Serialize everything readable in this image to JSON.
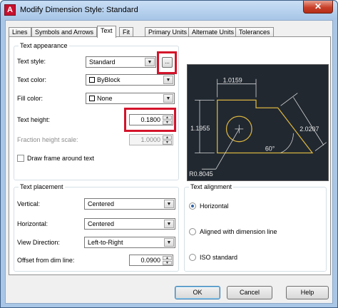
{
  "window": {
    "title": "Modify Dimension Style: Standard",
    "app_icon_letter": "A",
    "close_glyph": "✕"
  },
  "tabs": [
    {
      "label": "Lines"
    },
    {
      "label": "Symbols and Arrows"
    },
    {
      "label": "Text",
      "active": true
    },
    {
      "label": "Fit"
    },
    {
      "label": "Primary Units"
    },
    {
      "label": "Alternate Units"
    },
    {
      "label": "Tolerances"
    }
  ],
  "text_appearance": {
    "title": "Text appearance",
    "text_style_label": "Text style:",
    "text_style_value": "Standard",
    "text_style_browse": "...",
    "text_color_label": "Text color:",
    "text_color_value": "ByBlock",
    "fill_color_label": "Fill color:",
    "fill_color_value": "None",
    "text_height_label": "Text height:",
    "text_height_value": "0.1800",
    "fraction_label": "Fraction height scale:",
    "fraction_value": "1.0000",
    "frame_label": "Draw frame around text"
  },
  "text_placement": {
    "title": "Text placement",
    "vertical_label": "Vertical:",
    "vertical_value": "Centered",
    "horizontal_label": "Horizontal:",
    "horizontal_value": "Centered",
    "view_direction_label": "View Direction:",
    "view_direction_value": "Left-to-Right",
    "offset_label": "Offset from dim line:",
    "offset_value": "0.0900"
  },
  "text_alignment": {
    "title": "Text alignment",
    "options": [
      {
        "label": "Horizontal",
        "checked": true
      },
      {
        "label": "Aligned with dimension line",
        "checked": false
      },
      {
        "label": "ISO standard",
        "checked": false
      }
    ]
  },
  "preview": {
    "dim_top": "1.0159",
    "dim_left": "1.1955",
    "dim_right": "2.0207",
    "dim_angle": "60°",
    "dim_radius": "R0.8045",
    "bg_color": "#212830",
    "line_color": "#d9d9d9",
    "part_color": "#d8b340"
  },
  "buttons": {
    "ok": "OK",
    "cancel": "Cancel",
    "help": "Help"
  },
  "colors": {
    "highlight": "#d4132b",
    "title_bar": "#a8c6e8"
  }
}
